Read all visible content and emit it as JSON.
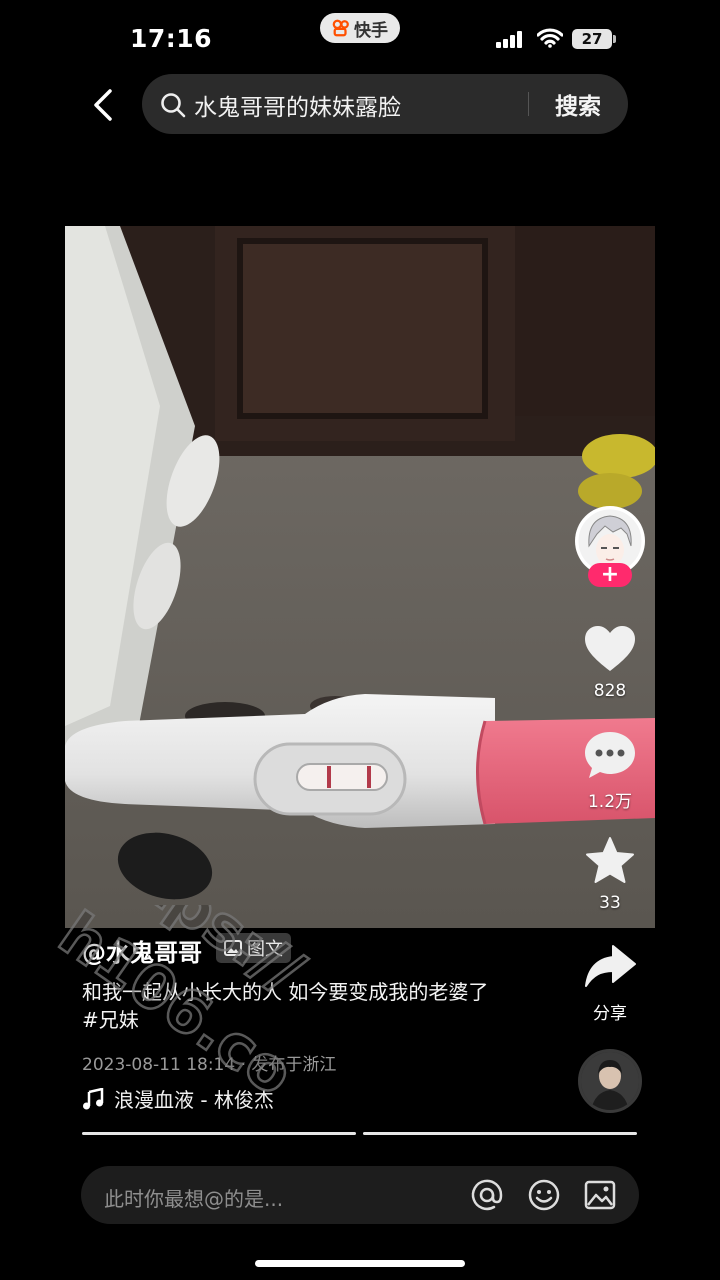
{
  "status_bar": {
    "time": "17:16",
    "battery": "27"
  },
  "app_pill": {
    "label": "快手"
  },
  "search": {
    "query": "水鬼哥哥的妹妹露脸",
    "button_label": "搜索"
  },
  "post": {
    "author": "@水鬼哥哥",
    "tag_label": "图文",
    "caption": "和我一起从小长大的人 如今要变成我的老婆了 #兄妹",
    "meta": "2023-08-11 18:14 · 发布于浙江",
    "music": "浪漫血液 - 林俊杰"
  },
  "actions": {
    "likes": "828",
    "comments": "1.2万",
    "favorites": "33",
    "share_label": "分享",
    "follow_label": "+"
  },
  "comment_bar": {
    "placeholder": "此时你最想@的是..."
  },
  "watermark": {
    "text_line1": "https://",
    "text_line2": "...料网",
    "text_line3": "h106.co"
  },
  "colors": {
    "accent": "#ff2a6d",
    "background": "#000000",
    "test_handle": "#e8647c"
  }
}
